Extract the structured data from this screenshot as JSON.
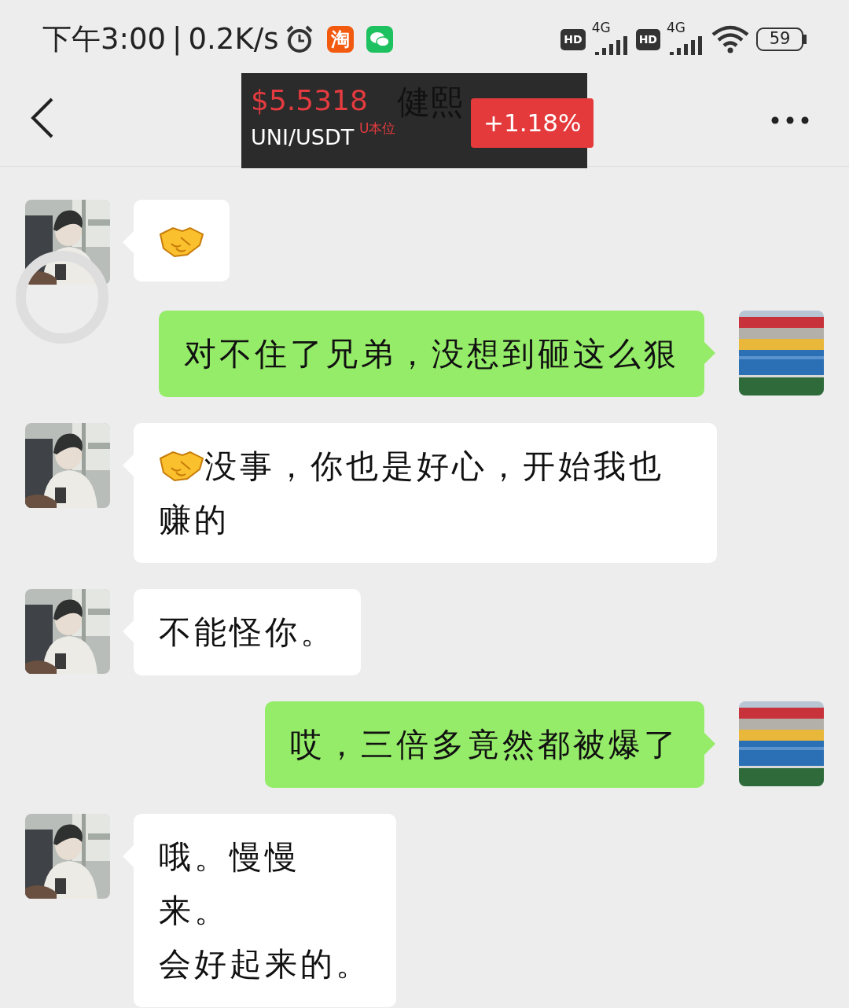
{
  "status_bar": {
    "time": "下午3:00",
    "separator": "|",
    "speed": "0.2K/s",
    "app_badge": "淘",
    "sim_1": {
      "hd": "HD",
      "network": "4G"
    },
    "sim_2": {
      "hd": "HD",
      "network": "4G"
    },
    "battery": "59"
  },
  "header": {
    "title": "健熙",
    "ticker": {
      "price": "$5.5318",
      "pair": "UNI/USDT",
      "pair_tag": "U本位",
      "change": "+1.18%"
    }
  },
  "messages": [
    {
      "outgoing": false,
      "kind": "sticker"
    },
    {
      "outgoing": true,
      "kind": "text",
      "emoji_prefix": false,
      "lines": [
        "对不住了兄弟，没想到砸这么狠"
      ]
    },
    {
      "outgoing": false,
      "kind": "text",
      "emoji_prefix": true,
      "lines": [
        "没事，你也是好心，开始我也赚的"
      ]
    },
    {
      "outgoing": false,
      "kind": "text",
      "emoji_prefix": false,
      "lines": [
        "不能怪你。"
      ]
    },
    {
      "outgoing": true,
      "kind": "text",
      "emoji_prefix": false,
      "lines": [
        "哎，三倍多竟然都被爆了"
      ]
    },
    {
      "outgoing": false,
      "kind": "text",
      "emoji_prefix": false,
      "lines": [
        "哦。慢慢",
        "来。",
        "会好起来的。"
      ]
    }
  ]
}
